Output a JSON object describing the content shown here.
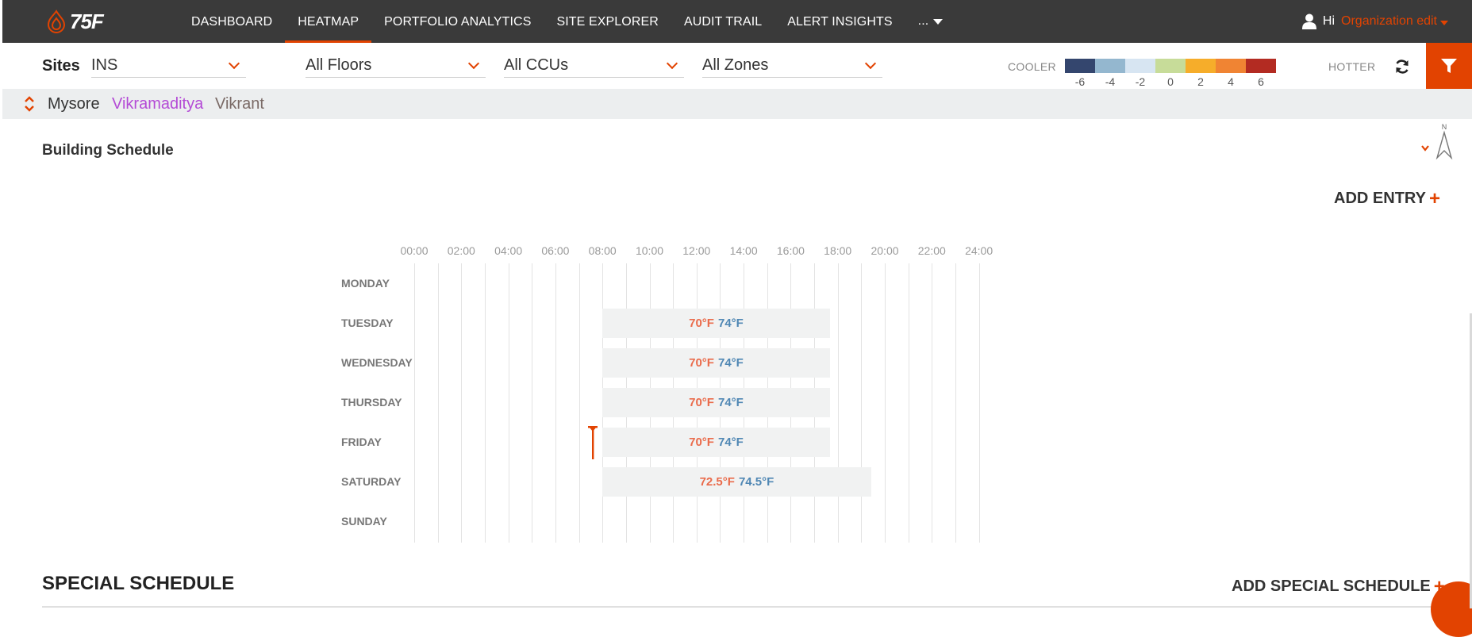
{
  "brand": {
    "name": "75F",
    "accent": "#e24301"
  },
  "nav": {
    "items": [
      {
        "label": "DASHBOARD",
        "active": false
      },
      {
        "label": "HEATMAP",
        "active": true
      },
      {
        "label": "PORTFOLIO ANALYTICS",
        "active": false
      },
      {
        "label": "SITE EXPLORER",
        "active": false
      },
      {
        "label": "AUDIT TRAIL",
        "active": false
      },
      {
        "label": "ALERT INSIGHTS",
        "active": false
      }
    ],
    "more_label": "..."
  },
  "user": {
    "greeting": "Hi",
    "org": "Organization edit",
    "icon": "user-icon"
  },
  "filters": {
    "sites_label": "Sites",
    "site": "INS",
    "floors": "All Floors",
    "ccus": "All CCUs",
    "zones": "All Zones"
  },
  "legend": {
    "cooler_label": "COOLER",
    "hotter_label": "HOTTER",
    "colors": [
      "#34466e",
      "#94b7cf",
      "#d7e5f2",
      "#c7dc99",
      "#f6ad2a",
      "#f08433",
      "#b32b22"
    ],
    "ticks": [
      "-6",
      "-4",
      "-2",
      "0",
      "2",
      "4",
      "6"
    ]
  },
  "site_tabs": [
    {
      "label": "Mysore",
      "color": "#333333"
    },
    {
      "label": "Vikramaditya",
      "color": "#b44bd6"
    },
    {
      "label": "Vikrant",
      "color": "#7a6a66"
    }
  ],
  "building_schedule": {
    "title": "Building Schedule",
    "add_entry_label": "ADD ENTRY",
    "hours": [
      "00:00",
      "02:00",
      "04:00",
      "06:00",
      "08:00",
      "10:00",
      "12:00",
      "14:00",
      "16:00",
      "18:00",
      "20:00",
      "22:00",
      "24:00"
    ],
    "days": [
      {
        "name": "MONDAY",
        "entries": []
      },
      {
        "name": "TUESDAY",
        "entries": [
          {
            "start": "08:00",
            "end": "17:40",
            "heat": "70°F",
            "cool": "74°F"
          }
        ]
      },
      {
        "name": "WEDNESDAY",
        "entries": [
          {
            "start": "08:00",
            "end": "17:40",
            "heat": "70°F",
            "cool": "74°F"
          }
        ]
      },
      {
        "name": "THURSDAY",
        "entries": [
          {
            "start": "08:00",
            "end": "17:40",
            "heat": "70°F",
            "cool": "74°F"
          }
        ]
      },
      {
        "name": "FRIDAY",
        "entries": [
          {
            "start": "08:00",
            "end": "17:40",
            "heat": "70°F",
            "cool": "74°F"
          }
        ]
      },
      {
        "name": "SATURDAY",
        "entries": [
          {
            "start": "08:00",
            "end": "19:25",
            "heat": "72.5°F",
            "cool": "74.5°F"
          }
        ]
      },
      {
        "name": "SUNDAY",
        "entries": []
      }
    ]
  },
  "special_schedule": {
    "title": "SPECIAL SCHEDULE",
    "add_label": "ADD SPECIAL SCHEDULE"
  }
}
